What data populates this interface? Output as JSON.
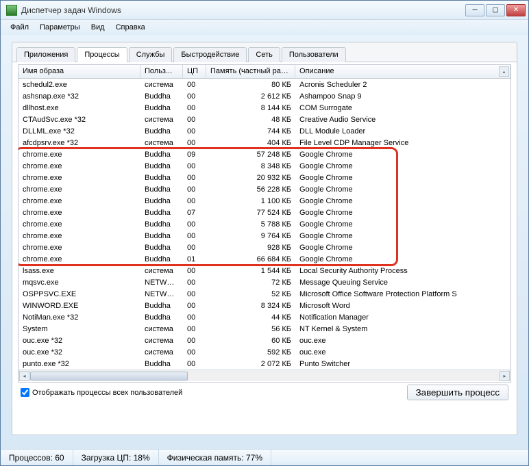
{
  "window": {
    "title": "Диспетчер задач Windows"
  },
  "menu": [
    "Файл",
    "Параметры",
    "Вид",
    "Справка"
  ],
  "tabs": [
    "Приложения",
    "Процессы",
    "Службы",
    "Быстродействие",
    "Сеть",
    "Пользователи"
  ],
  "active_tab": 1,
  "columns": [
    "Имя образа",
    "Польз...",
    "ЦП",
    "Память (частный рабо...",
    "Описание"
  ],
  "rows": [
    {
      "name": "schedul2.exe",
      "user": "система",
      "cpu": "00",
      "mem": "80 КБ",
      "desc": "Acronis Scheduler 2",
      "hl": false
    },
    {
      "name": "ashsnap.exe *32",
      "user": "Buddha",
      "cpu": "00",
      "mem": "2 612 КБ",
      "desc": "Ashampoo Snap 9",
      "hl": false
    },
    {
      "name": "dllhost.exe",
      "user": "Buddha",
      "cpu": "00",
      "mem": "8 144 КБ",
      "desc": "COM Surrogate",
      "hl": false
    },
    {
      "name": "CTAudSvc.exe *32",
      "user": "система",
      "cpu": "00",
      "mem": "48 КБ",
      "desc": "Creative Audio Service",
      "hl": false
    },
    {
      "name": "DLLML.exe *32",
      "user": "Buddha",
      "cpu": "00",
      "mem": "744 КБ",
      "desc": "DLL Module Loader",
      "hl": false
    },
    {
      "name": "afcdpsrv.exe *32",
      "user": "система",
      "cpu": "00",
      "mem": "404 КБ",
      "desc": "File Level CDP Manager Service",
      "hl": false
    },
    {
      "name": "chrome.exe",
      "user": "Buddha",
      "cpu": "09",
      "mem": "57 248 КБ",
      "desc": "Google Chrome",
      "hl": true
    },
    {
      "name": "chrome.exe",
      "user": "Buddha",
      "cpu": "00",
      "mem": "8 348 КБ",
      "desc": "Google Chrome",
      "hl": true
    },
    {
      "name": "chrome.exe",
      "user": "Buddha",
      "cpu": "00",
      "mem": "20 932 КБ",
      "desc": "Google Chrome",
      "hl": true
    },
    {
      "name": "chrome.exe",
      "user": "Buddha",
      "cpu": "00",
      "mem": "56 228 КБ",
      "desc": "Google Chrome",
      "hl": true
    },
    {
      "name": "chrome.exe",
      "user": "Buddha",
      "cpu": "00",
      "mem": "1 100 КБ",
      "desc": "Google Chrome",
      "hl": true
    },
    {
      "name": "chrome.exe",
      "user": "Buddha",
      "cpu": "07",
      "mem": "77 524 КБ",
      "desc": "Google Chrome",
      "hl": true
    },
    {
      "name": "chrome.exe",
      "user": "Buddha",
      "cpu": "00",
      "mem": "5 788 КБ",
      "desc": "Google Chrome",
      "hl": true
    },
    {
      "name": "chrome.exe",
      "user": "Buddha",
      "cpu": "00",
      "mem": "9 764 КБ",
      "desc": "Google Chrome",
      "hl": true
    },
    {
      "name": "chrome.exe",
      "user": "Buddha",
      "cpu": "00",
      "mem": "928 КБ",
      "desc": "Google Chrome",
      "hl": true
    },
    {
      "name": "chrome.exe",
      "user": "Buddha",
      "cpu": "01",
      "mem": "66 684 КБ",
      "desc": "Google Chrome",
      "hl": true
    },
    {
      "name": "lsass.exe",
      "user": "система",
      "cpu": "00",
      "mem": "1 544 КБ",
      "desc": "Local Security Authority Process",
      "hl": false
    },
    {
      "name": "mqsvc.exe",
      "user": "NETWO...",
      "cpu": "00",
      "mem": "72 КБ",
      "desc": "Message Queuing Service",
      "hl": false
    },
    {
      "name": "OSPPSVC.EXE",
      "user": "NETWO...",
      "cpu": "00",
      "mem": "52 КБ",
      "desc": "Microsoft Office Software Protection Platform S",
      "hl": false
    },
    {
      "name": "WINWORD.EXE",
      "user": "Buddha",
      "cpu": "00",
      "mem": "8 324 КБ",
      "desc": "Microsoft Word",
      "hl": false
    },
    {
      "name": "NotiMan.exe *32",
      "user": "Buddha",
      "cpu": "00",
      "mem": "44 КБ",
      "desc": "Notification Manager",
      "hl": false
    },
    {
      "name": "System",
      "user": "система",
      "cpu": "00",
      "mem": "56 КБ",
      "desc": "NT Kernel & System",
      "hl": false
    },
    {
      "name": "ouc.exe *32",
      "user": "система",
      "cpu": "00",
      "mem": "60 КБ",
      "desc": "ouc.exe",
      "hl": false
    },
    {
      "name": "ouc.exe *32",
      "user": "система",
      "cpu": "00",
      "mem": "592 КБ",
      "desc": "ouc.exe",
      "hl": false
    },
    {
      "name": "punto.exe *32",
      "user": "Buddha",
      "cpu": "00",
      "mem": "2 072 КБ",
      "desc": "Punto Switcher",
      "hl": false
    }
  ],
  "checkbox_label": "Отображать процессы всех пользователей",
  "end_process_label": "Завершить процесс",
  "status": {
    "processes": "Процессов: 60",
    "cpu": "Загрузка ЦП: 18%",
    "mem": "Физическая память: 77%"
  }
}
